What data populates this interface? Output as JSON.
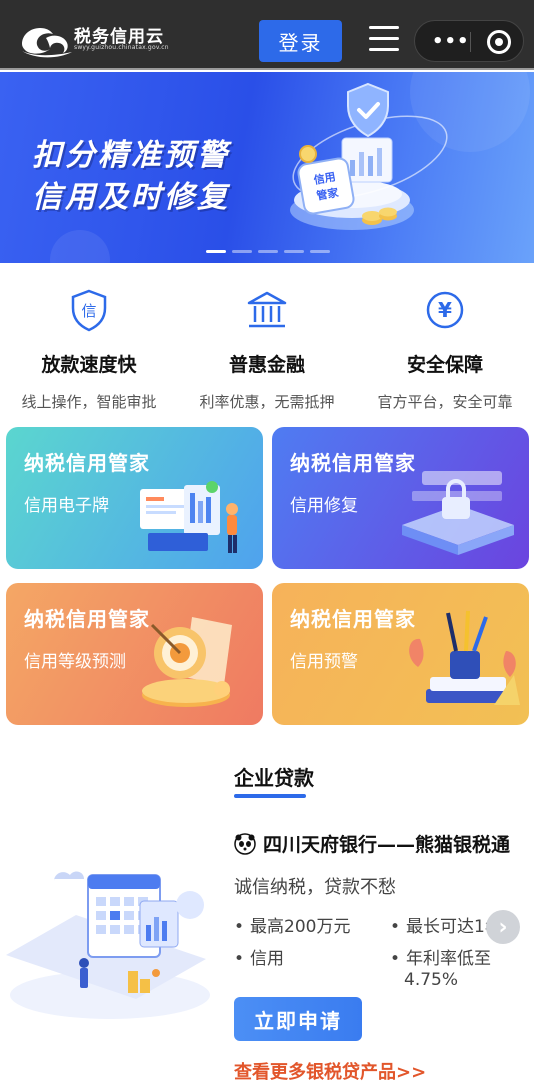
{
  "header": {
    "logo_text": "税务信用云",
    "logo_url": "swyy.guizhou.chinatax.gov.cn",
    "login_label": "登录"
  },
  "banner": {
    "line1": "扣分精准预警",
    "line2": "信用及时修复",
    "badge_text": "信用\n管家",
    "slide_count": 5,
    "active_slide": 1
  },
  "features": [
    {
      "icon": "shield-icon",
      "icon_text": "信",
      "title": "放款速度快",
      "subtitle": "线上操作，智能审批"
    },
    {
      "icon": "bank-building-icon",
      "title": "普惠金融",
      "subtitle": "利率优惠，无需抵押"
    },
    {
      "icon": "yuan-icon",
      "icon_text": "¥",
      "title": "安全保障",
      "subtitle": "官方平台，安全可靠"
    }
  ],
  "cards": [
    {
      "title": "纳税信用管家",
      "subtitle": "信用电子牌",
      "colors": [
        "#5bd6cf",
        "#4fa2ee"
      ]
    },
    {
      "title": "纳税信用管家",
      "subtitle": "信用修复",
      "colors": [
        "#4f7cf2",
        "#6b44df"
      ]
    },
    {
      "title": "纳税信用管家",
      "subtitle": "信用等级预测",
      "colors": [
        "#f4a765",
        "#ef7a62"
      ]
    },
    {
      "title": "纳税信用管家",
      "subtitle": "信用预警",
      "colors": [
        "#f6b25a",
        "#f2c054"
      ]
    }
  ],
  "loan": {
    "section_title": "企业贷款",
    "bank_name": "四川天府银行——熊猫银税通",
    "slogan": "诚信纳税，贷款不愁",
    "bullets": [
      "最高200万元",
      "最长可达1年",
      "信用",
      "年利率低至",
      "4.75%"
    ],
    "apply_label": "立即申请",
    "more_link": "查看更多银税贷产品>>"
  },
  "colors": {
    "accent": "#2d6ae9",
    "link": "#e2562b"
  }
}
